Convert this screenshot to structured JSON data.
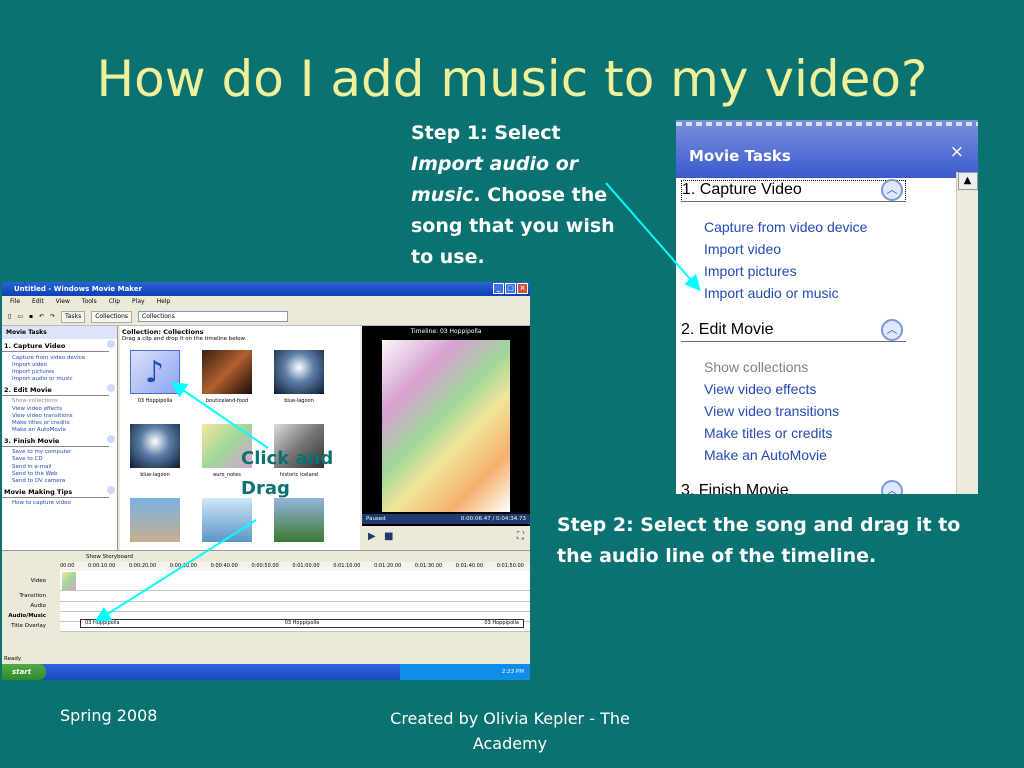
{
  "slide": {
    "title": "How do I add music to my video?",
    "step1_a": "Step 1: Select",
    "step1_italic": "Import audio or music",
    "step1_b": ".  Choose the song that you wish to use.",
    "step2": "Step 2: Select the song and drag it to the audio line of the timeline.",
    "click_drag": "Click and Drag",
    "footer_left": "Spring 2008",
    "footer_center": "Created by Olivia Kepler - The Academy"
  },
  "zoom_panel": {
    "title": "Movie Tasks",
    "close": "×",
    "section1": "1. Capture Video",
    "section1_links": [
      "Capture from video device",
      "Import video",
      "Import pictures",
      "Import audio or music"
    ],
    "section2": "2. Edit Movie",
    "section2_links": [
      "Show collections",
      "View video effects",
      "View video transitions",
      "Make titles or credits",
      "Make an AutoMovie"
    ],
    "section3": "3. Finish Movie"
  },
  "wmm": {
    "title": "Untitled - Windows Movie Maker",
    "menu": [
      "File",
      "Edit",
      "View",
      "Tools",
      "Clip",
      "Play",
      "Help"
    ],
    "toolbar_tasks": "Tasks",
    "toolbar_collections": "Collections",
    "toolbar_select": "Collections",
    "left_header": "Movie Tasks",
    "capture": "1. Capture Video",
    "capture_links": [
      "Capture from video device",
      "Import video",
      "Import pictures",
      "Import audio or music"
    ],
    "edit": "2. Edit Movie",
    "edit_links": [
      "Show collections",
      "View video effects",
      "View video transitions",
      "Make titles or credits",
      "Make an AutoMovie"
    ],
    "finish": "3. Finish Movie",
    "finish_links": [
      "Save to my computer",
      "Save to CD",
      "Send in e-mail",
      "Send to the Web",
      "Send to DV camera"
    ],
    "tips": "Movie Making Tips",
    "tips_links": [
      "How to capture video"
    ],
    "coll_title": "Collection: Collections",
    "coll_sub": "Drag a clip and drop it on the timeline below.",
    "thumbs": [
      "03 Hoppipolla",
      "bouticeland-food",
      "blue-lagoon",
      "blue-lagoon",
      "euro_notes",
      "historic iceland"
    ],
    "preview_title": "Timeline: 03 Hoppipolla",
    "preview_state": "Paused",
    "preview_time": "0:00:06.47 / 0:04:34.73",
    "storyboard": "Show Storyboard",
    "ruler": [
      "00:00",
      "0:00:10.00",
      "0:00:20.00",
      "0:00:30.00",
      "0:00:40.00",
      "0:00:50.00",
      "0:01:00.00",
      "0:01:10.00",
      "0:01:20.00",
      "0:01:30.00",
      "0:01:40.00",
      "0:01:50.00"
    ],
    "tracks": [
      "Video",
      "Transition",
      "Audio",
      "Audio/Music",
      "Title Overlay"
    ],
    "audio_clip": [
      "03 Hoppipolla",
      "03 Hoppipolla",
      "03 Hoppipolla"
    ],
    "status": "Ready",
    "start": "start",
    "clock": "2:23 PM"
  }
}
